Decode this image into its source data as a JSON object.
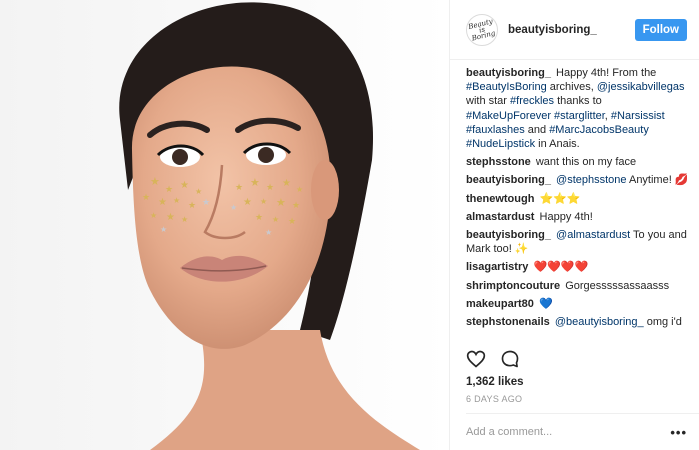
{
  "post": {
    "image_alt": "Portrait of a woman with gold and silver star glitter on her cheek",
    "author": {
      "avatar_text": "Beauty is Boring",
      "username": "beautyisboring_"
    },
    "follow_label": "Follow",
    "caption": {
      "author": "beautyisboring_",
      "segments": [
        {
          "text": "Happy 4th! From the ",
          "tag": false
        },
        {
          "text": "#BeautyIsBoring",
          "tag": true
        },
        {
          "text": " archives, ",
          "tag": false
        },
        {
          "text": "@jessikabvillegas",
          "tag": true
        },
        {
          "text": " with star ",
          "tag": false
        },
        {
          "text": "#freckles",
          "tag": true
        },
        {
          "text": " thanks to ",
          "tag": false
        },
        {
          "text": "#MakeUpForever",
          "tag": true
        },
        {
          "text": " ",
          "tag": false
        },
        {
          "text": "#starglitter",
          "tag": true
        },
        {
          "text": ", ",
          "tag": false
        },
        {
          "text": "#Narsissist",
          "tag": true
        },
        {
          "text": " ",
          "tag": false
        },
        {
          "text": "#fauxlashes",
          "tag": true
        },
        {
          "text": " and ",
          "tag": false
        },
        {
          "text": "#MarcJacobsBeauty",
          "tag": true
        },
        {
          "text": " ",
          "tag": false
        },
        {
          "text": "#NudeLipstick",
          "tag": true
        },
        {
          "text": " in Anais.",
          "tag": false
        }
      ]
    },
    "comments": [
      {
        "author": "stephsstone",
        "segments": [
          {
            "text": "want this on my face",
            "tag": false
          }
        ]
      },
      {
        "author": "beautyisboring_",
        "segments": [
          {
            "text": "@stephsstone",
            "tag": true
          },
          {
            "text": " Anytime! 💋",
            "tag": false
          }
        ]
      },
      {
        "author": "thenewtough",
        "segments": [
          {
            "text": "⭐⭐⭐",
            "tag": false
          }
        ]
      },
      {
        "author": "almastardust",
        "segments": [
          {
            "text": "Happy 4th!",
            "tag": false
          }
        ]
      },
      {
        "author": "beautyisboring_",
        "segments": [
          {
            "text": "@almastardust",
            "tag": true
          },
          {
            "text": " To you and Mark too! ✨",
            "tag": false
          }
        ]
      },
      {
        "author": "lisagartistry",
        "segments": [
          {
            "text": "❤️❤️❤️❤️",
            "tag": false
          }
        ]
      },
      {
        "author": "shrimptoncouture",
        "segments": [
          {
            "text": "Gorgesssssassaasss",
            "tag": false
          }
        ]
      },
      {
        "author": "makeupart80",
        "segments": [
          {
            "text": "💙",
            "tag": false
          }
        ]
      },
      {
        "author": "stephstonenails",
        "segments": [
          {
            "text": "@beautyisboring_",
            "tag": true
          },
          {
            "text": " omg i'd",
            "tag": false
          }
        ]
      }
    ],
    "icons": {
      "like": "heart-icon",
      "comment": "comment-bubble-icon",
      "more": "more-options-icon"
    },
    "likes": "1,362 likes",
    "date": "6 DAYS AGO",
    "add_comment_placeholder": "Add a comment...",
    "more_label": "•••",
    "colors": {
      "follow": "#3897f0",
      "tag": "#003569",
      "muted": "#999999"
    }
  }
}
